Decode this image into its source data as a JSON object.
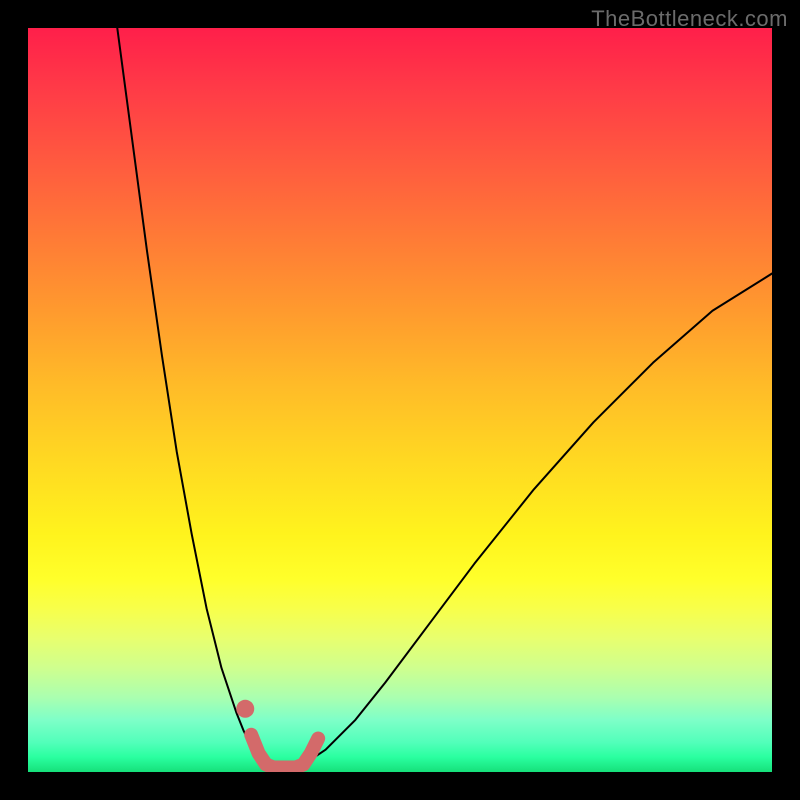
{
  "watermark": "TheBottleneck.com",
  "chart_data": {
    "type": "line",
    "title": "",
    "xlabel": "",
    "ylabel": "",
    "xlim": [
      0,
      100
    ],
    "ylim": [
      0,
      100
    ],
    "grid": false,
    "legend": false,
    "background": "rainbow-gradient red(top) to green(bottom)",
    "series": [
      {
        "name": "curve-left",
        "color": "#000000",
        "width": 2,
        "x": [
          12,
          14,
          16,
          18,
          20,
          22,
          24,
          26,
          28,
          29,
          30,
          31,
          32
        ],
        "y": [
          100,
          85,
          70,
          56,
          43,
          32,
          22,
          14,
          8,
          5.5,
          3.5,
          2,
          1
        ]
      },
      {
        "name": "curve-right",
        "color": "#000000",
        "width": 2,
        "x": [
          37,
          40,
          44,
          48,
          54,
          60,
          68,
          76,
          84,
          92,
          100
        ],
        "y": [
          1,
          3,
          7,
          12,
          20,
          28,
          38,
          47,
          55,
          62,
          67
        ]
      },
      {
        "name": "floor",
        "color": "#000000",
        "width": 2,
        "x": [
          32,
          37
        ],
        "y": [
          0.5,
          0.5
        ]
      },
      {
        "name": "highlight-band",
        "color": "#d36a6a",
        "width": 14,
        "x": [
          30,
          31,
          32,
          33,
          34,
          35,
          36,
          37,
          38,
          39
        ],
        "y": [
          5,
          2.5,
          1,
          0.6,
          0.6,
          0.6,
          0.6,
          1,
          2.5,
          4.5
        ]
      },
      {
        "name": "highlight-dot",
        "color": "#d36a6a",
        "type": "scatter",
        "x": [
          29.2
        ],
        "y": [
          8.5
        ],
        "size": 9
      }
    ]
  }
}
